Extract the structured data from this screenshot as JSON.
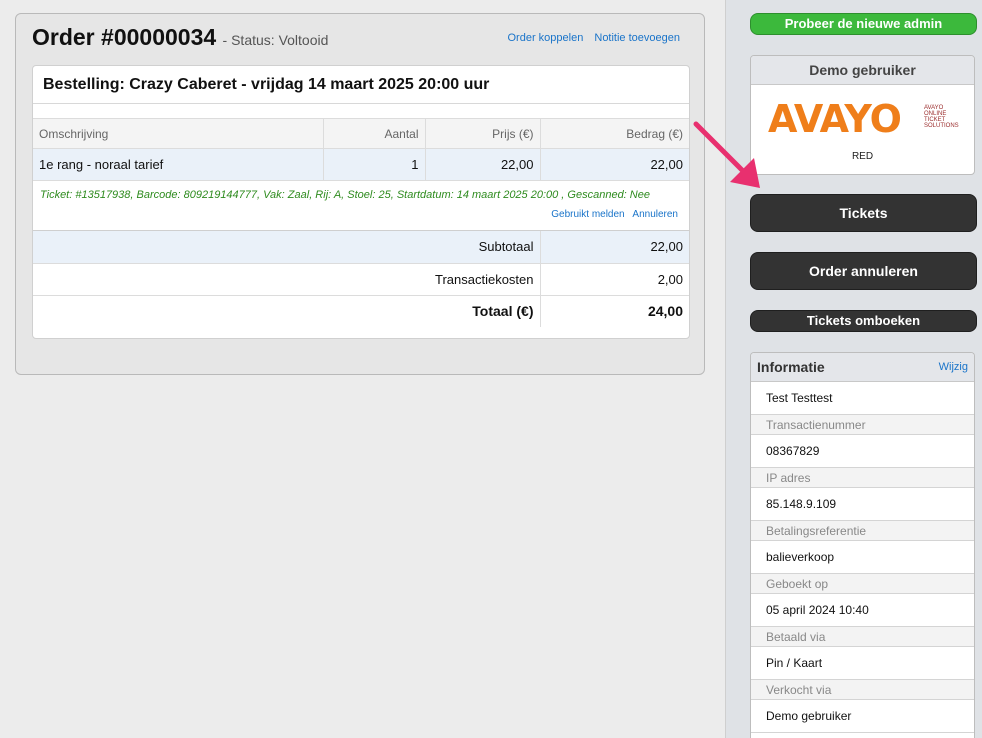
{
  "order": {
    "title": "Order #00000034",
    "status": "- Status: Voltooid",
    "actions": [
      "Order koppelen",
      "Notitie toevoegen"
    ]
  },
  "booking": {
    "heading": "Bestelling: Crazy Caberet - vrijdag 14 maart 2025 20:00 uur",
    "columns": [
      "Omschrijving",
      "Aantal",
      "Prijs (€)",
      "Bedrag (€)"
    ],
    "line": {
      "description": "1e rang - noraal tarief",
      "quantity": "1",
      "price": "22,00",
      "amount": "22,00"
    },
    "ticket_info": "Ticket: #13517938, Barcode: 809219144777, Vak: Zaal, Rij: A, Stoel: 25, Startdatum: 14 maart 2025 20:00 , Gescanned: Nee",
    "ticket_links": [
      "Gebruikt melden",
      "Annuleren"
    ],
    "totals": {
      "subtotal_label": "Subtotaal",
      "subtotal_value": "22,00",
      "fee_label": "Transactiekosten",
      "fee_value": "2,00",
      "total_label": "Totaal (€)",
      "total_value": "24,00"
    }
  },
  "sidebar": {
    "new_admin_button": "Probeer de nieuwe admin",
    "demo_box": {
      "heading": "Demo gebruiker",
      "logo_word": "AVAYO",
      "logo_tagline": [
        "AVAYO",
        "ONLINE",
        "TICKET",
        "SOLUTIONS"
      ],
      "caption": "RED"
    },
    "tickets_button": "Tickets",
    "cancel_button": "Order annuleren",
    "rebook_button": "Tickets omboeken",
    "info": {
      "heading": "Informatie",
      "edit_link": "Wijzig",
      "customer": "Test Testtest",
      "fields": [
        {
          "label": "Transactienummer",
          "value": "08367829"
        },
        {
          "label": "IP adres",
          "value": "85.148.9.109"
        },
        {
          "label": "Betalingsreferentie",
          "value": "balieverkoop"
        },
        {
          "label": "Geboekt op",
          "value": "05 april 2024 10:40"
        },
        {
          "label": "Betaald via",
          "value": "Pin / Kaart"
        },
        {
          "label": "Verkocht via",
          "value": "Demo gebruiker"
        }
      ]
    }
  },
  "colors": {
    "accent_green": "#3cb93c",
    "dark_button": "#333333",
    "link_blue": "#1a74c9",
    "ticket_text_green": "#2e8b1e",
    "arrow_pink": "#e8306f",
    "logo_orange": "#ef7e1a"
  },
  "icons": {
    "annotation": "arrow-icon"
  }
}
